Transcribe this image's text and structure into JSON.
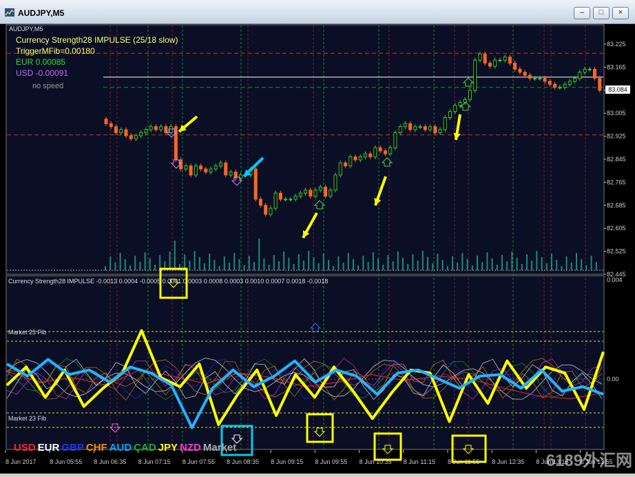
{
  "window": {
    "title": "AUDJPY,M5",
    "buttons": [
      "–",
      "□",
      "×"
    ]
  },
  "main_panel": {
    "symbol_label": "AUDJPY,M5",
    "indicator_lines": [
      {
        "text": "Currency Strength28 IMPULSE (25/18 slow)",
        "color": "#ffff66"
      },
      {
        "text": "TriggerMFib=0.00180",
        "color": "#ffff66"
      },
      {
        "text": "EUR 0.00085",
        "color": "#33dd33"
      },
      {
        "text": "USD -0.00091",
        "color": "#cc66ff"
      },
      {
        "text": "no speed",
        "color": "#999999"
      }
    ],
    "price_label": "83.084"
  },
  "sub_panel": {
    "title": "Currency Strength28 IMPULSE  -0.0013 0.0004 -0.0005 0.0001 0.0003 0.0008 0.0003 0.0010 0.0007 0.0018 -0.0018",
    "market_labels": [
      "Market 59 Fib",
      "Market 23 Fib",
      "Market 23 Fib"
    ]
  },
  "legend": [
    {
      "text": "USD",
      "color": "#ff2222"
    },
    {
      "text": "EUR",
      "color": "#ffffff"
    },
    {
      "text": "GBP",
      "color": "#2233ff"
    },
    {
      "text": "CHF",
      "color": "#ff8800"
    },
    {
      "text": "AUD",
      "color": "#00aaff"
    },
    {
      "text": "CAD",
      "color": "#22aa22"
    },
    {
      "text": "JPY",
      "color": "#ffff00"
    },
    {
      "text": "NZD",
      "color": "#ff33cc"
    },
    {
      "text": "Market",
      "color": "#aaaaaa"
    }
  ],
  "watermark": "6189外汇网",
  "chart_data": [
    {
      "type": "candlestick",
      "title": "AUDJPY,M5",
      "y_ticks": [
        "83.225",
        "83.165",
        "83.085",
        "83.005",
        "82.925",
        "82.845",
        "82.765",
        "82.685",
        "82.605",
        "82.525",
        "82.445"
      ],
      "ylim": [
        82.445,
        83.225
      ],
      "x_ticks": [
        "8 Jun 2017",
        "8 Jun 05:55",
        "8 Jun 06:35",
        "8 Jun 07:15",
        "8 Jun 07:55",
        "8 Jun 08:35",
        "8 Jun 09:15",
        "8 Jun 09:55",
        "8 Jun 10:35",
        "8 Jun 11:15",
        "8 Jun 11:55",
        "8 Jun 12:35",
        "8 Jun 13:15",
        "8 Jun 13:55"
      ],
      "close": [
        82.93,
        82.92,
        82.9,
        82.91,
        82.89,
        82.88,
        82.89,
        82.9,
        82.91,
        82.92,
        82.91,
        82.92,
        82.9,
        82.92,
        82.81,
        82.78,
        82.79,
        82.76,
        82.79,
        82.78,
        82.77,
        82.78,
        82.79,
        82.8,
        82.76,
        82.77,
        82.75,
        82.76,
        82.76,
        82.78,
        82.68,
        82.66,
        82.63,
        82.65,
        82.7,
        82.68,
        82.68,
        82.68,
        82.69,
        82.7,
        82.71,
        82.69,
        82.71,
        82.72,
        82.69,
        82.71,
        82.76,
        82.8,
        82.79,
        82.82,
        82.81,
        82.82,
        82.83,
        82.82,
        82.85,
        82.84,
        82.83,
        82.85,
        82.9,
        82.92,
        82.93,
        82.91,
        82.92,
        82.92,
        82.91,
        82.92,
        82.9,
        82.91,
        82.95,
        82.97,
        82.99,
        83.0,
        83.01,
        83.04,
        83.14,
        83.16,
        83.13,
        83.12,
        83.14,
        83.14,
        83.15,
        83.13,
        83.11,
        83.1,
        83.09,
        83.08,
        83.08,
        83.08,
        83.07,
        83.06,
        83.05,
        83.05,
        83.06,
        83.07,
        83.08,
        83.1,
        83.11,
        83.11,
        83.08,
        83.04
      ],
      "current_price": 83.084,
      "horizontal_lines": [
        83.14,
        83.05,
        82.92
      ]
    },
    {
      "type": "line",
      "title": "Currency Strength28 IMPULSE",
      "y_ticks": [
        "0.004",
        "0.00"
      ],
      "series": [
        {
          "name": "USD",
          "values": [
            0.0005,
            -0.0002,
            0.0001,
            -0.0004,
            0.0006,
            0.0002,
            -0.0003,
            0.0004,
            0.0001,
            -0.0005,
            -0.0002,
            0.0003,
            -0.0001,
            0.0002,
            0.0,
            -0.0006,
            -0.0011,
            -0.0013,
            -0.0009
          ]
        },
        {
          "name": "JPY",
          "values": [
            -0.0004,
            0.0008,
            -0.0012,
            0.0006,
            -0.0018,
            -0.0006,
            0.0004,
            0.0032,
            0.0001,
            -0.0005,
            0.001,
            -0.003,
            -0.001,
            0.0006,
            -0.0024,
            0.0003,
            -0.0012,
            0.0008,
            -0.0008,
            -0.0026,
            -0.0009,
            0.0006,
            0.0004,
            -0.0028,
            0.0003,
            -0.0016,
            0.0012,
            -0.0006,
            0.0008,
            0.0004,
            -0.002,
            0.0018
          ]
        },
        {
          "name": "AUD",
          "values": [
            0.001,
            0.0002,
            0.0013,
            0.0003,
            0.0006,
            -0.0002,
            0.0008,
            0.0004,
            -0.0004,
            -0.0032,
            -0.0006,
            0.0006,
            -0.0005,
            0.0002,
            0.0012,
            -0.0002,
            0.0006,
            0.0002,
            -0.001,
            0.0004,
            0.0006,
            0.0,
            -0.0006,
            0.0002,
            0.0003,
            -0.0006,
            0.0006,
            -0.0008,
            -0.0005,
            -0.001
          ]
        }
      ]
    }
  ]
}
